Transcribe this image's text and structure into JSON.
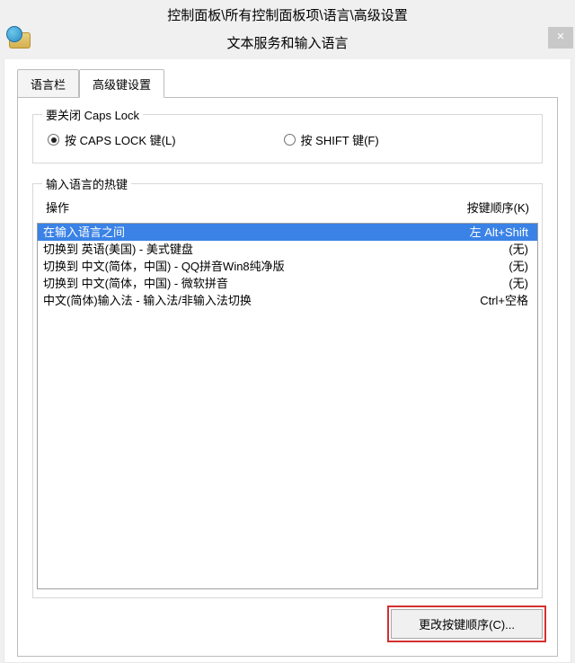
{
  "breadcrumb": "控制面板\\所有控制面板项\\语言\\高级设置",
  "dialog_title": "文本服务和输入语言",
  "close_label": "×",
  "tabs": {
    "lang_bar": "语言栏",
    "adv_keys": "高级键设置"
  },
  "capslock": {
    "legend": "要关闭 Caps Lock",
    "opt_caps": "按 CAPS LOCK 键(L)",
    "opt_shift": "按 SHIFT 键(F)"
  },
  "hotkeys": {
    "legend": "输入语言的热键",
    "col_action": "操作",
    "col_keys": "按键顺序(K)",
    "rows": [
      {
        "action": "在输入语言之间",
        "keys": "左 Alt+Shift",
        "selected": true
      },
      {
        "action": "切换到 英语(美国) - 美式键盘",
        "keys": "(无)",
        "selected": false
      },
      {
        "action": "切换到 中文(简体，中国) - QQ拼音Win8纯净版",
        "keys": "(无)",
        "selected": false
      },
      {
        "action": "切换到 中文(简体，中国) - 微软拼音",
        "keys": "(无)",
        "selected": false
      },
      {
        "action": "中文(简体)输入法 - 输入法/非输入法切换",
        "keys": "Ctrl+空格",
        "selected": false
      }
    ]
  },
  "change_btn": "更改按键顺序(C)..."
}
